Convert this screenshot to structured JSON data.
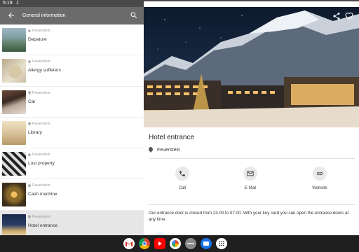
{
  "status": {
    "time": "5:19",
    "download_glyph": "⇩"
  },
  "toolbar": {
    "title": "General information"
  },
  "list": [
    {
      "location": "Feuerstein",
      "label": "Depature"
    },
    {
      "location": "Feuerstein",
      "label": "Allergy sufferers"
    },
    {
      "location": "Feuerstein",
      "label": "Car"
    },
    {
      "location": "Feuerstein",
      "label": "Library"
    },
    {
      "location": "Feuerstein",
      "label": "Lost property"
    },
    {
      "location": "Feuerstein",
      "label": "Cash machine"
    },
    {
      "location": "Feuerstein",
      "label": "Hotel entrance"
    }
  ],
  "detail": {
    "title": "Hotel entrance",
    "location": "Feuerstein",
    "actions": {
      "call": "Call",
      "email": "E-Mail",
      "website": "Website"
    },
    "description": "Our entrance door is closed from 23.00 to 07.00. With your key card you can open the entrance doors at any time."
  },
  "dock": [
    "gmail-icon",
    "chrome-icon",
    "youtube-icon",
    "photos-icon",
    "app-icon",
    "files-icon",
    "apps-grid-icon"
  ],
  "colors": {
    "toolbar": "#6b6b6b",
    "selected_row": "#e6e6e6",
    "taskbar": "#1f1f1f"
  }
}
